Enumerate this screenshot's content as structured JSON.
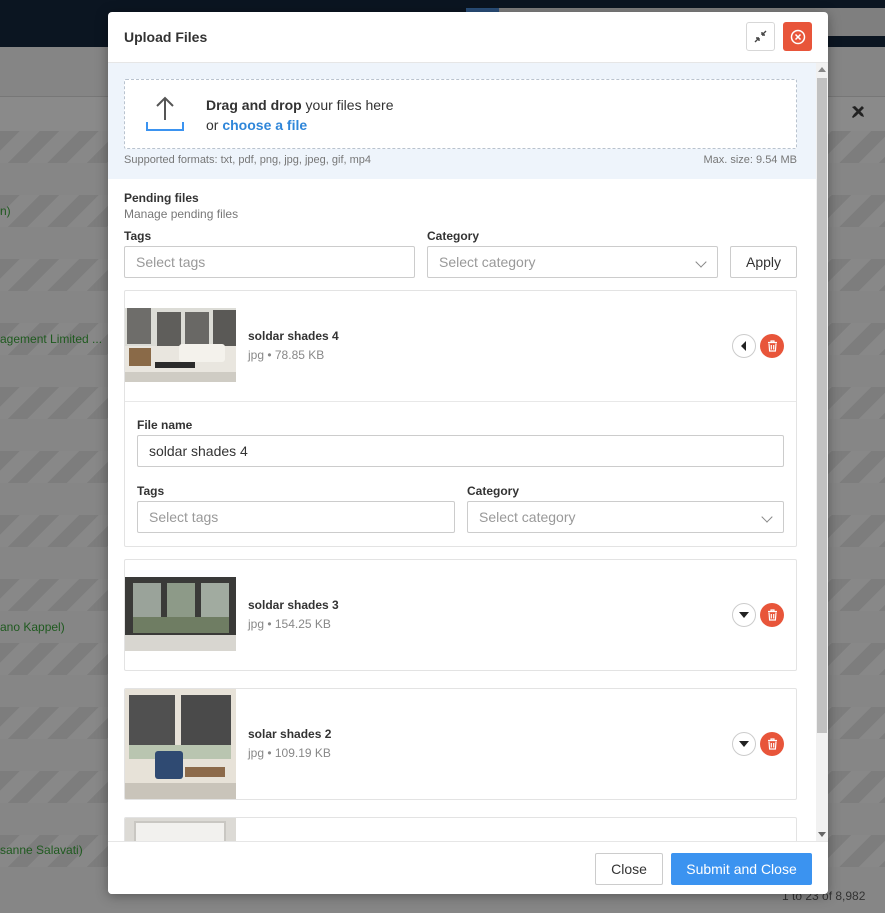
{
  "modal": {
    "title": "Upload Files",
    "dropzone": {
      "bold_text": "Drag and drop",
      "text": " your files here",
      "or_text": "or ",
      "choose_link": "choose a file"
    },
    "supported_formats": "Supported formats: txt, pdf, png, jpg, jpeg, gif, mp4",
    "max_size": "Max. size: 9.54 MB",
    "pending": {
      "title": "Pending files",
      "subtitle": "Manage pending files",
      "tags_label": "Tags",
      "tags_placeholder": "Select tags",
      "category_label": "Category",
      "category_placeholder": "Select category",
      "apply_label": "Apply"
    },
    "files": [
      {
        "name": "soldar shades 4",
        "meta": "jpg • 78.85 KB",
        "expanded": true,
        "detail": {
          "file_name_label": "File name",
          "file_name_value": "soldar shades 4",
          "tags_label": "Tags",
          "tags_placeholder": "Select tags",
          "category_label": "Category",
          "category_placeholder": "Select category"
        }
      },
      {
        "name": "soldar shades 3",
        "meta": "jpg • 154.25 KB",
        "expanded": false
      },
      {
        "name": "solar shades 2",
        "meta": "jpg • 109.19 KB",
        "expanded": false
      }
    ],
    "footer": {
      "close_label": "Close",
      "submit_label": "Submit and Close"
    }
  },
  "background": {
    "links": [
      "n)",
      "agement Limited ...",
      "ano Kappel)",
      "sanne Salavati)"
    ],
    "pagination": "1 to 23 of 8,982"
  },
  "colors": {
    "accent": "#3b93f0",
    "danger": "#e8553a",
    "link": "#2f86d9"
  }
}
